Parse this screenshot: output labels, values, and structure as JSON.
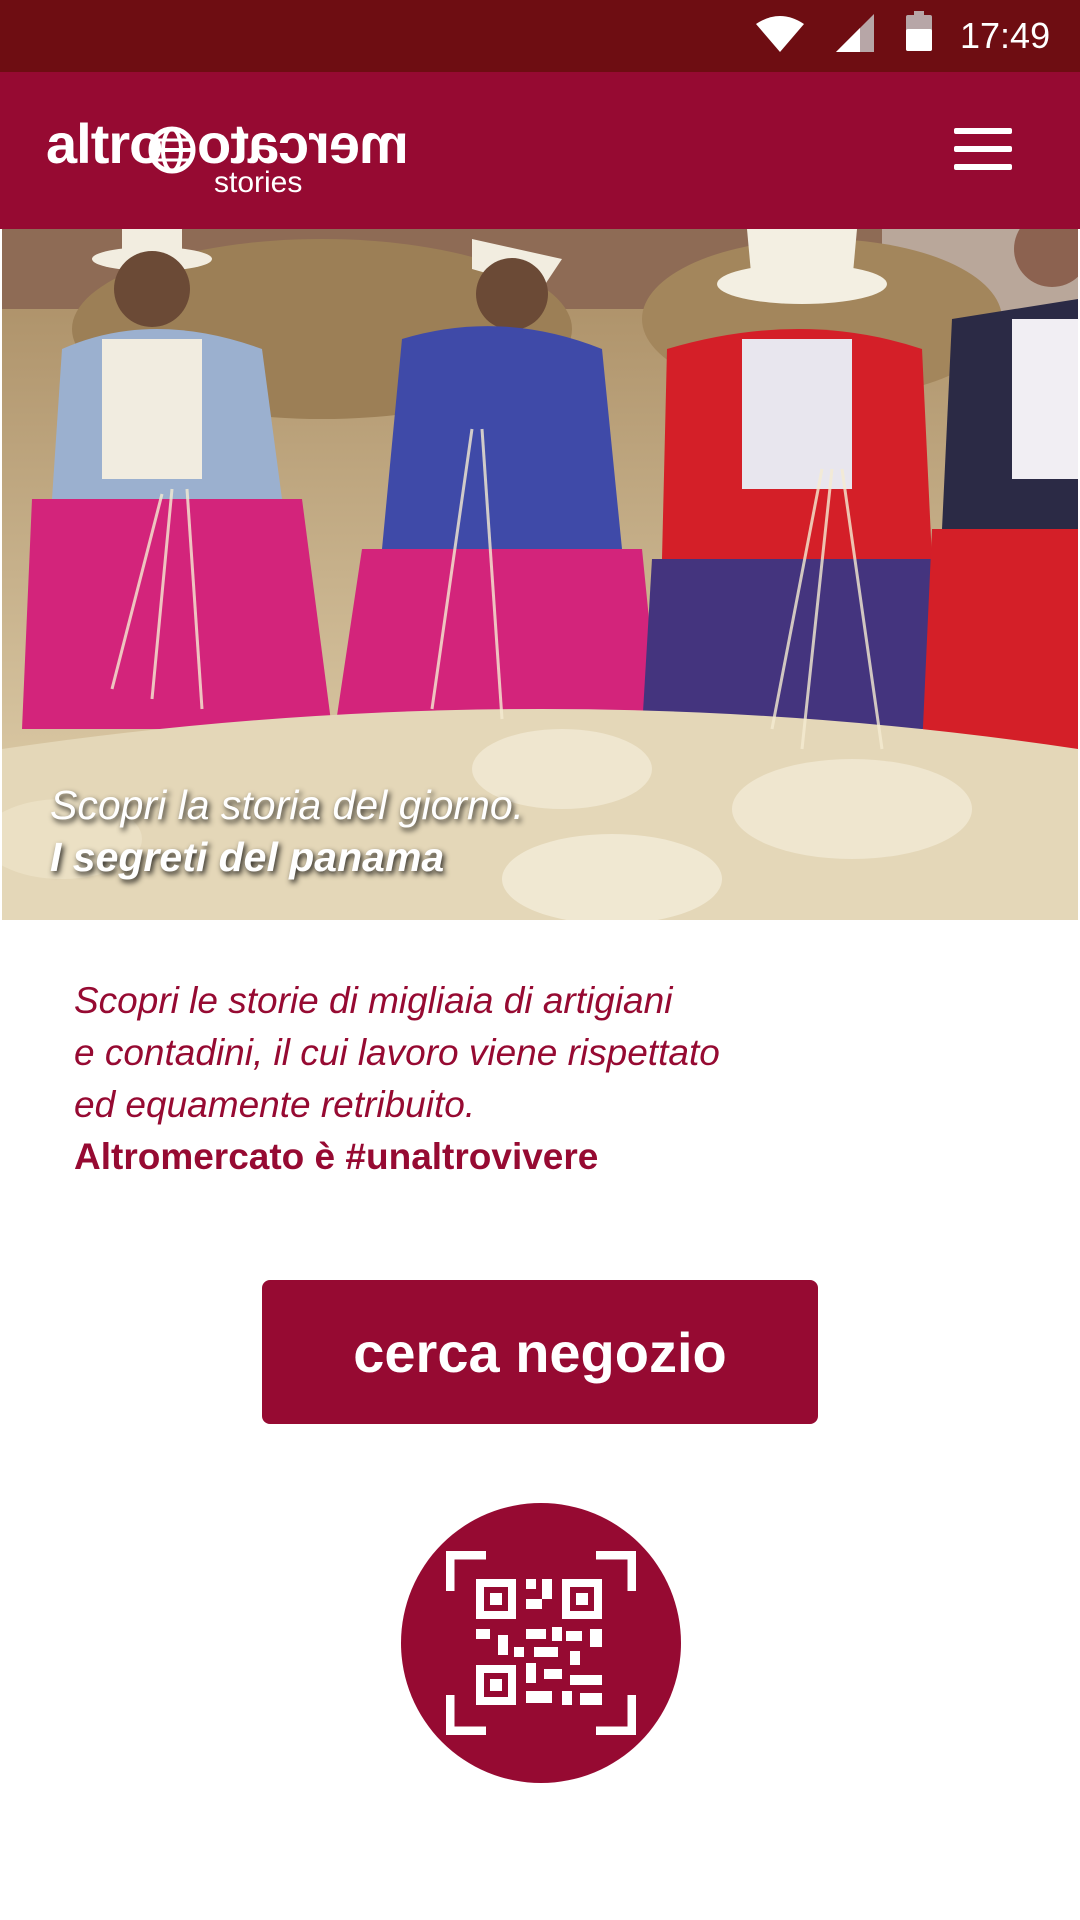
{
  "status_bar": {
    "time": "17:49",
    "icons": [
      "wifi-icon",
      "signal-icon",
      "battery-icon"
    ]
  },
  "app_bar": {
    "logo": {
      "text_left": "altro",
      "text_right": "mercato",
      "subtitle": "stories"
    },
    "menu_icon": "hamburger-menu-icon"
  },
  "hero": {
    "caption_line1": "Scopri la storia del giorno.",
    "caption_line2": "I segreti del panama"
  },
  "intro": {
    "line1": "Scopri le storie di migliaia di artigiani",
    "line2": "e contadini, il cui lavoro viene rispettato",
    "line3": "ed equamente retribuito.",
    "tagline": "Altromercato è #unaltrovivere"
  },
  "actions": {
    "search_store_label": "cerca negozio",
    "qr_icon": "qr-code-scan-icon"
  },
  "colors": {
    "brand": "#960a32",
    "status_bar": "#6e0d12",
    "background": "#ffffff"
  }
}
